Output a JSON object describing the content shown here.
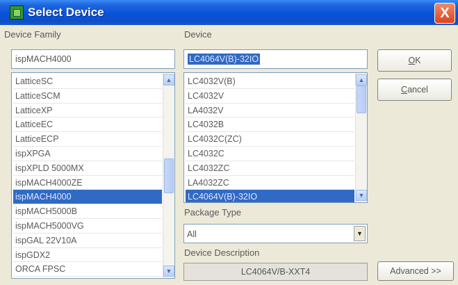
{
  "window": {
    "title": "Select Device",
    "close_label": "X"
  },
  "family": {
    "label": "Device Family",
    "value": "ispMACH4000",
    "items": [
      "LatticeSC",
      "LatticeSCM",
      "LatticeXP",
      "LatticeEC",
      "LatticeECP",
      "ispXPGA",
      "ispXPLD 5000MX",
      "ispMACH4000ZE",
      "ispMACH4000",
      "ispMACH5000B",
      "ispMACH5000VG",
      "ispGAL 22V10A",
      "ispGDX2",
      "ORCA FPSC"
    ],
    "selected_index": 8,
    "scroll_position": 0.5
  },
  "device": {
    "label": "Device",
    "value": "LC4064V(B)-32IO",
    "items": [
      "LC4032V(B)",
      "LC4032V",
      "LA4032V",
      "LC4032B",
      "LC4032C(ZC)",
      "LC4032C",
      "LC4032ZC",
      "LA4032ZC",
      "LC4064V(B)-32IO"
    ],
    "selected_index": 8,
    "scroll_position": 0.0
  },
  "package": {
    "label": "Package Type",
    "value": "All"
  },
  "description": {
    "label": "Device Description",
    "value": "LC4064V/B-XXT4"
  },
  "buttons": {
    "ok_accel": "O",
    "ok_rest": "K",
    "cancel_accel": "C",
    "cancel_rest": "ancel",
    "advanced": "Advanced >>"
  },
  "icons": {
    "scroll_up": "▲",
    "scroll_down": "▼",
    "dropdown": "▼"
  }
}
